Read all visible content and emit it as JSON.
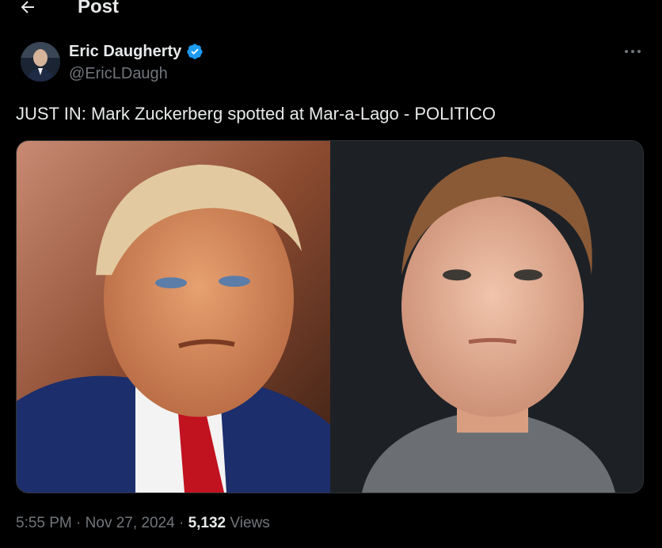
{
  "header": {
    "title": "Post",
    "back_icon": "arrow-left-icon"
  },
  "author": {
    "display_name": "Eric Daugherty",
    "handle": "@EricLDaugh",
    "verified_icon": "verified-badge-icon",
    "verified_color": "#1d9bf0"
  },
  "more_icon": "more-horizontal-icon",
  "tweet": {
    "text": "JUST IN: Mark Zuckerberg spotted at Mar-a-Lago - POLITICO"
  },
  "media": {
    "count": 2
  },
  "meta": {
    "time": "5:55 PM",
    "separator1": " · ",
    "date": "Nov 27, 2024",
    "separator2": " · ",
    "views_count": "5,132",
    "views_label": " Views"
  },
  "colors": {
    "background": "#000000",
    "text_primary": "#e7e9ea",
    "text_secondary": "#71767b",
    "accent": "#1d9bf0"
  }
}
